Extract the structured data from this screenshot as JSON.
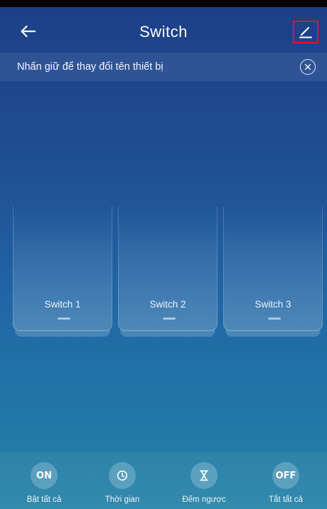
{
  "header": {
    "title": "Switch",
    "back_icon": "arrow-left-icon",
    "edit_icon": "pencil-icon"
  },
  "banner": {
    "text": "Nhấn giữ để thay đổi tên thiết bị",
    "close_icon": "close-circle-icon"
  },
  "switches": [
    {
      "label": "Switch 1"
    },
    {
      "label": "Switch 2"
    },
    {
      "label": "Switch 3"
    }
  ],
  "actions": [
    {
      "label": "Bật tất cả",
      "icon_text": "ON",
      "icon": "on-text-icon"
    },
    {
      "label": "Thời gian",
      "icon": "clock-icon"
    },
    {
      "label": "Đếm ngược",
      "icon": "hourglass-icon"
    },
    {
      "label": "Tắt tất cả",
      "icon_text": "OFF",
      "icon": "off-text-icon"
    }
  ],
  "colors": {
    "background_top": "#1d3f88",
    "background_bottom": "#2784a9",
    "highlight_border": "#e0142a"
  }
}
